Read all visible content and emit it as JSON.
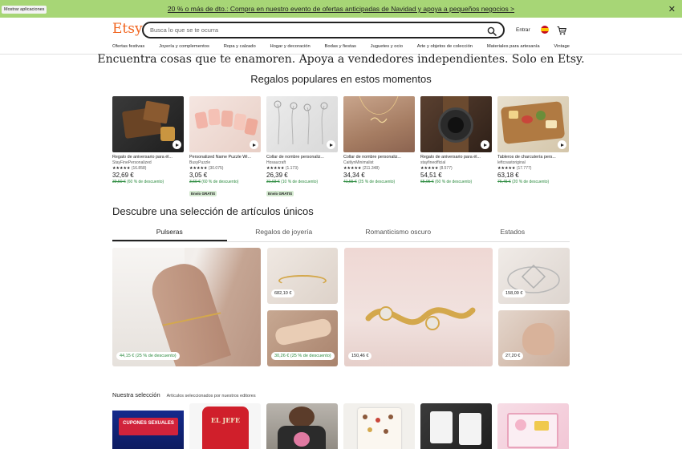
{
  "banner": {
    "apps_label": "Mostrar aplicaciones",
    "promo_text": "20 % o más de dto.: Compra en nuestro evento de ofertas anticipadas de Navidad y apoya a pequeños negocios >",
    "bg_color": "#a7d676"
  },
  "header": {
    "logo": "Etsy",
    "logo_color": "#f1641e",
    "search_placeholder": "Busca lo que se te ocurra",
    "signin_label": "Entrar",
    "flag_icon": "spain-flag-icon",
    "cart_icon": "cart-icon"
  },
  "categories": [
    "Ofertas festivas",
    "Joyería y complementos",
    "Ropa y calzado",
    "Hogar y decoración",
    "Bodas y fiestas",
    "Juguetes y ocio",
    "Arte y objetos de colección",
    "Materiales para artesanía",
    "Vintage"
  ],
  "tagline": "Encuentra cosas que te enamoren. Apoya a vendedores independientes. Solo en Etsy.",
  "popular_heading": "Regalos populares en estos momentos",
  "products": [
    {
      "title": "Regalo de aniversario para él...",
      "shop": "StayFinePersonalized",
      "stars": "★★★★★",
      "count": "(16.858)",
      "price": "32,69 €",
      "original": "39,50 €",
      "discount": "(60 % de descuento)",
      "free_shipping": ""
    },
    {
      "title": "Personalized Name Puzzle Wi...",
      "shop": "BusyPuzzle",
      "stars": "★★★★★",
      "count": "(30.075)",
      "price": "3,05 €",
      "original": "3,69 €",
      "discount": "(60 % de descuento)",
      "free_shipping": "Envío GRATIS"
    },
    {
      "title": "Collar de nombre personaliz...",
      "shop": "Hosaucraft",
      "stars": "★★★★★",
      "count": "(1.173)",
      "price": "26,39 €",
      "original": "31,93 €",
      "discount": "(10 % de descuento)",
      "free_shipping": "Envío GRATIS"
    },
    {
      "title": "Collar de nombre personaliz...",
      "shop": "CaitlynMinimalist",
      "stars": "★★★★★",
      "count": "(211.348)",
      "price": "34,34 €",
      "original": "41,55 €",
      "discount": "(25 % de descuento)",
      "free_shipping": ""
    },
    {
      "title": "Regalo de aniversario para él...",
      "shop": "stayfineofficial",
      "stars": "★★★★★",
      "count": "(8.577)",
      "price": "54,51 €",
      "original": "65,95 €",
      "discount": "(60 % de descuento)",
      "free_shipping": ""
    },
    {
      "title": "Tableros de charcutería pers...",
      "shop": "leftcoastoriginal",
      "stars": "★★★★★",
      "count": "(17.777)",
      "price": "63,18 €",
      "original": "76,45 €",
      "discount": "(20 % de descuento)",
      "free_shipping": ""
    }
  ],
  "discover_heading": "Descubre una selección de artículos únicos",
  "tabs": [
    "Pulseras",
    "Regalos de joyería",
    "Romanticismo oscuro",
    "Estados"
  ],
  "mosaic_prices": {
    "t1": "44,15 € (25 % de descuento)",
    "t2": "682,10 €",
    "t3": "30,26 € (25 % de descuento)",
    "t4": "150,46 €",
    "t5": "158,09 €",
    "t6": "27,20 €"
  },
  "editors": {
    "heading": "Nuestra selección",
    "subtitle": "Artículos seleccionados por nuestros editores",
    "image_text_1": "CUPONES SEXUALES",
    "image_text_2": "EL JEFE"
  }
}
